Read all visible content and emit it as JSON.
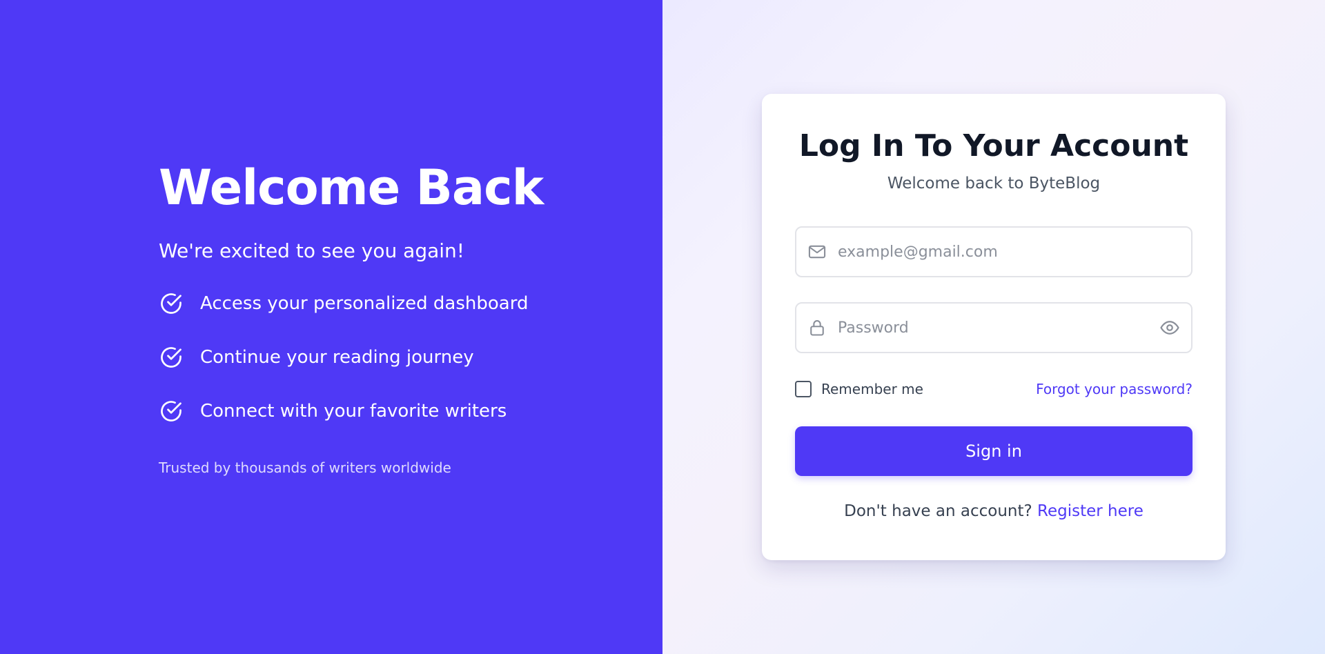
{
  "hero": {
    "title": "Welcome Back",
    "subtitle": "We're excited to see you again!",
    "features": [
      {
        "label": "Access your personalized dashboard",
        "icon": "check-circle-icon"
      },
      {
        "label": "Continue your reading journey",
        "icon": "check-circle-icon"
      },
      {
        "label": "Connect with your favorite writers",
        "icon": "check-circle-icon"
      }
    ],
    "trusted": "Trusted by thousands of writers worldwide"
  },
  "login": {
    "title": "Log In To Your Account",
    "subtitle": "Welcome back to ByteBlog",
    "email": {
      "value": "",
      "placeholder": "example@gmail.com",
      "icon": "mail-icon"
    },
    "password": {
      "value": "",
      "placeholder": "Password",
      "icon": "lock-icon",
      "toggle_icon": "eye-icon"
    },
    "remember_label": "Remember me",
    "remember_checked": false,
    "forgot_label": "Forgot your password?",
    "submit_label": "Sign in",
    "register_prompt": "Don't have an account?",
    "register_link": "Register here"
  },
  "colors": {
    "brand": "#4f39f6",
    "heading": "#111827",
    "muted": "#4b5563"
  }
}
